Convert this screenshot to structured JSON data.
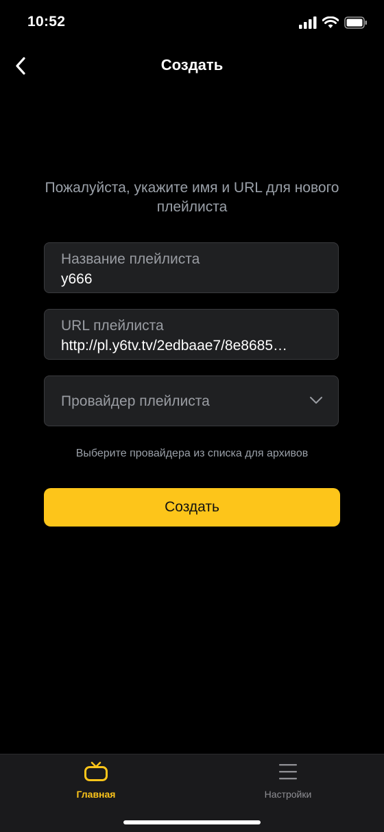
{
  "status_bar": {
    "time": "10:52",
    "icons": [
      "cellular-signal-icon",
      "wifi-icon",
      "battery-icon"
    ]
  },
  "nav": {
    "back_icon": "chevron-left-icon",
    "title": "Создать"
  },
  "form": {
    "instruction": "Пожалуйста, укажите имя и URL для нового плейлиста",
    "name_field": {
      "label": "Название плейлиста",
      "value": "y666"
    },
    "url_field": {
      "label": "URL плейлиста",
      "value": "http://pl.y6tv.tv/2edbaae7/8e8685…"
    },
    "provider_field": {
      "label": "Провайдер плейлиста",
      "icon": "chevron-down-icon"
    },
    "hint": "Выберите провайдера из списка для архивов",
    "submit_label": "Создать"
  },
  "tab_bar": {
    "tabs": [
      {
        "label": "Главная",
        "icon": "tv-icon",
        "active": true
      },
      {
        "label": "Настройки",
        "icon": "menu-icon",
        "active": false
      }
    ]
  },
  "colors": {
    "accent": "#fdc51a",
    "background": "#000000",
    "field_background": "#1f2022",
    "muted_text": "#9aa0a8"
  }
}
